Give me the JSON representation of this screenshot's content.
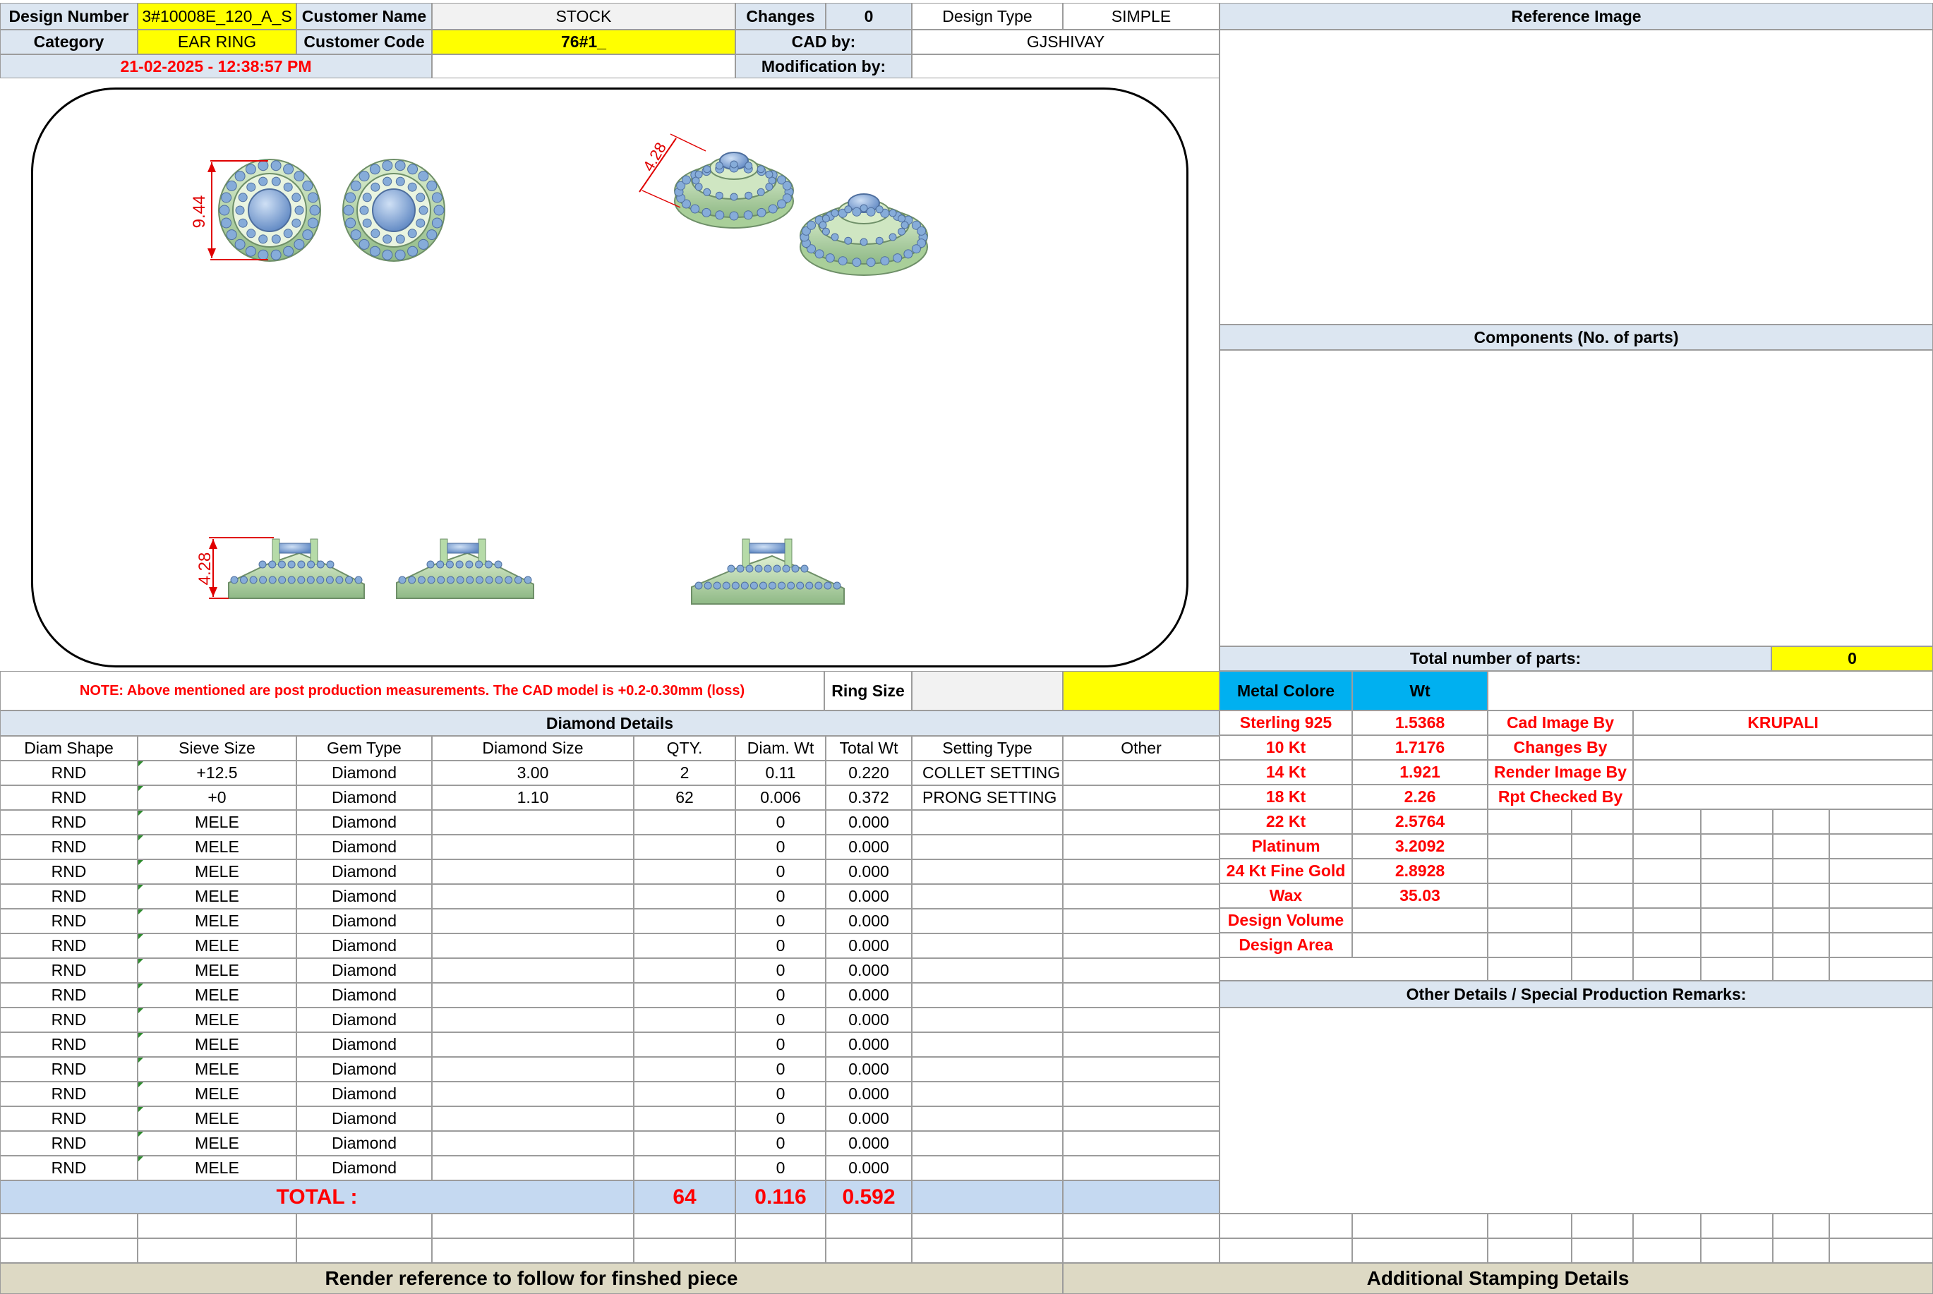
{
  "header": {
    "design_number_label": "Design Number",
    "design_number": "3#10008E_120_A_S",
    "customer_name_label": "Customer Name",
    "customer_name": "STOCK",
    "changes_label": "Changes",
    "changes": "0",
    "design_type_label": "Design Type",
    "design_type": "SIMPLE",
    "category_label": "Category",
    "category": "EAR RING",
    "customer_code_label": "Customer Code",
    "customer_code": "76#1_",
    "cad_by_label": "CAD by:",
    "cad_by": "GJSHIVAY",
    "datetime": "21-02-2025 - 12:38:57 PM",
    "modification_by_label": "Modification by:",
    "modification_by": ""
  },
  "drawing": {
    "dim_top_view": "9.44",
    "dim_iso_view": "4.28",
    "dim_side_view": "4.28"
  },
  "right_panel": {
    "reference_image_label": "Reference Image",
    "components_label": "Components (No. of parts)",
    "total_parts_label": "Total number of parts:",
    "total_parts": "0",
    "metal_colore_label": "Metal Colore",
    "wt_label": "Wt"
  },
  "note": {
    "text": "NOTE: Above mentioned are post production measurements. The CAD model is +0.2-0.30mm (loss)",
    "ring_size_label": "Ring Size",
    "ring_size_value": ""
  },
  "diamond": {
    "title": "Diamond Details",
    "headers": [
      "Diam Shape",
      "Sieve Size",
      "Gem Type",
      "Diamond Size",
      "QTY.",
      "Diam. Wt",
      "Total Wt",
      "Setting Type",
      "Other"
    ],
    "rows": [
      [
        "RND",
        "+12.5",
        "Diamond",
        "3.00",
        "2",
        "0.11",
        "0.220",
        "COLLET SETTING",
        ""
      ],
      [
        "RND",
        "+0",
        "Diamond",
        "1.10",
        "62",
        "0.006",
        "0.372",
        "PRONG SETTING",
        ""
      ],
      [
        "RND",
        "MELE",
        "Diamond",
        "",
        "",
        "0",
        "0.000",
        "",
        ""
      ],
      [
        "RND",
        "MELE",
        "Diamond",
        "",
        "",
        "0",
        "0.000",
        "",
        ""
      ],
      [
        "RND",
        "MELE",
        "Diamond",
        "",
        "",
        "0",
        "0.000",
        "",
        ""
      ],
      [
        "RND",
        "MELE",
        "Diamond",
        "",
        "",
        "0",
        "0.000",
        "",
        ""
      ],
      [
        "RND",
        "MELE",
        "Diamond",
        "",
        "",
        "0",
        "0.000",
        "",
        ""
      ],
      [
        "RND",
        "MELE",
        "Diamond",
        "",
        "",
        "0",
        "0.000",
        "",
        ""
      ],
      [
        "RND",
        "MELE",
        "Diamond",
        "",
        "",
        "0",
        "0.000",
        "",
        ""
      ],
      [
        "RND",
        "MELE",
        "Diamond",
        "",
        "",
        "0",
        "0.000",
        "",
        ""
      ],
      [
        "RND",
        "MELE",
        "Diamond",
        "",
        "",
        "0",
        "0.000",
        "",
        ""
      ],
      [
        "RND",
        "MELE",
        "Diamond",
        "",
        "",
        "0",
        "0.000",
        "",
        ""
      ],
      [
        "RND",
        "MELE",
        "Diamond",
        "",
        "",
        "0",
        "0.000",
        "",
        ""
      ],
      [
        "RND",
        "MELE",
        "Diamond",
        "",
        "",
        "0",
        "0.000",
        "",
        ""
      ],
      [
        "RND",
        "MELE",
        "Diamond",
        "",
        "",
        "0",
        "0.000",
        "",
        ""
      ],
      [
        "RND",
        "MELE",
        "Diamond",
        "",
        "",
        "0",
        "0.000",
        "",
        ""
      ],
      [
        "RND",
        "MELE",
        "Diamond",
        "",
        "",
        "0",
        "0.000",
        "",
        ""
      ]
    ],
    "total_label": "TOTAL :",
    "total_qty": "64",
    "total_diam_wt": "0.116",
    "total_wt": "0.592"
  },
  "metals": [
    {
      "name": "Sterling 925",
      "wt": "1.5368"
    },
    {
      "name": "10 Kt",
      "wt": "1.7176"
    },
    {
      "name": "14 Kt",
      "wt": "1.921"
    },
    {
      "name": "18 Kt",
      "wt": "2.26"
    },
    {
      "name": "22 Kt",
      "wt": "2.5764"
    },
    {
      "name": "Platinum",
      "wt": "3.2092"
    },
    {
      "name": "24 Kt Fine Gold",
      "wt": "2.8928"
    },
    {
      "name": "Wax",
      "wt": "35.03"
    },
    {
      "name": "Design Volume",
      "wt": ""
    },
    {
      "name": "Design Area",
      "wt": ""
    }
  ],
  "credits": [
    {
      "label": "Cad Image By",
      "value": "KRUPALI"
    },
    {
      "label": "Changes By",
      "value": ""
    },
    {
      "label": "Render Image By",
      "value": ""
    },
    {
      "label": "Rpt Checked By",
      "value": ""
    }
  ],
  "other_details_label": "Other Details / Special Production Remarks:",
  "footer": {
    "render_reference": "Render reference to follow for finshed piece",
    "stamping": "Additional Stamping Details"
  },
  "colors": {
    "header_blue": "#dce6f1",
    "highlight_yellow": "#ffff00",
    "metal_cyan": "#00b0f0",
    "total_row_blue": "#c5d9f1",
    "footer_tan": "#ddd9c4",
    "accent_red": "#ff0000",
    "metal_green": "#b6dba8",
    "stone_blue": "#7fa6d6"
  }
}
